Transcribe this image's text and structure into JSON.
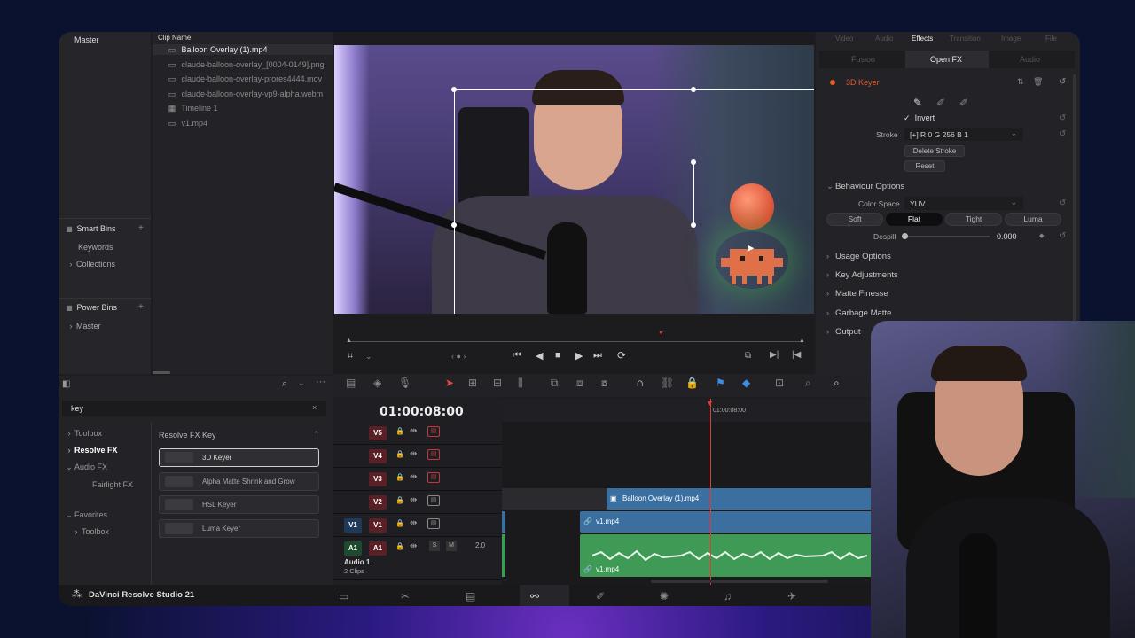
{
  "media_pool": {
    "master_label": "Master",
    "column_header": "Clip Name",
    "clips": [
      {
        "name": "Balloon Overlay (1).mp4",
        "icon": "video-clip-icon"
      },
      {
        "name": "claude-balloon-overlay_[0004-0149].png",
        "icon": "image-sequence-icon"
      },
      {
        "name": "claude-balloon-overlay-prores4444.mov",
        "icon": "video-clip-icon"
      },
      {
        "name": "claude-balloon-overlay-vp9-alpha.webm",
        "icon": "video-clip-icon"
      },
      {
        "name": "Timeline 1",
        "icon": "timeline-icon"
      },
      {
        "name": "v1.mp4",
        "icon": "video-clip-icon"
      }
    ],
    "smart_bins": {
      "title": "Smart Bins",
      "items": [
        "Keywords",
        "Collections"
      ]
    },
    "power_bins": {
      "title": "Power Bins",
      "items": [
        "Master"
      ]
    }
  },
  "effects_library": {
    "search_value": "key",
    "categories": [
      {
        "label": "Toolbox",
        "expanded": false
      },
      {
        "label": "Resolve FX",
        "expanded": true,
        "selected": true
      },
      {
        "label": "Audio FX",
        "expanded": true
      },
      {
        "label": "Fairlight FX",
        "expanded": false
      }
    ],
    "favorites": {
      "label": "Favorites",
      "items": [
        "Toolbox"
      ]
    },
    "group_title": "Resolve FX Key",
    "results": [
      "3D Keyer",
      "Alpha Matte Shrink and Grow",
      "HSL Keyer",
      "Luma Keyer"
    ]
  },
  "viewer": {
    "timecode": "01:00:08:00"
  },
  "inspector": {
    "tabs": [
      "Video",
      "Audio",
      "Effects",
      "Transition",
      "Image",
      "File"
    ],
    "active_tab": "Effects",
    "subtabs": [
      "Fusion",
      "Open FX",
      "Audio"
    ],
    "active_subtab": "Open FX",
    "effect_name": "3D Keyer",
    "invert_label": "Invert",
    "stroke_label": "Stroke",
    "stroke_value": "[+]   R 0   G 256   B 1",
    "delete_stroke": "Delete Stroke",
    "reset": "Reset",
    "behaviour_title": "Behaviour Options",
    "color_space_label": "Color Space",
    "color_space_value": "YUV",
    "modes": [
      "Soft",
      "Flat",
      "Tight",
      "Luma"
    ],
    "active_mode": "Flat",
    "despill_label": "Despill",
    "despill_value": "0.000",
    "sections": [
      "Usage Options",
      "Key Adjustments",
      "Matte Finesse",
      "Garbage Matte",
      "Output"
    ]
  },
  "timeline": {
    "ruler_time": "01:00:08:00",
    "tracks": [
      {
        "label": "V5"
      },
      {
        "label": "V4"
      },
      {
        "label": "V3"
      },
      {
        "label": "V2"
      },
      {
        "label": "V1",
        "side": "V1"
      },
      {
        "label": "A1",
        "side": "A1",
        "volume": "2.0"
      }
    ],
    "audio_track_name": "Audio 1",
    "audio_track_clips": "2 Clips",
    "solo_label": "S",
    "mute_label": "M",
    "clips": {
      "v2": "Balloon Overlay (1).mp4",
      "v1": "v1.mp4",
      "a1": "v1.mp4"
    }
  },
  "footer": {
    "app_name": "DaVinci Resolve Studio 21"
  },
  "colors": {
    "accent_orange": "#e05a2a",
    "active_tab": "#e8e8e8",
    "playhead": "#e03a3a",
    "video_clip": "#3a6fa0",
    "audio_clip": "#3f9a55",
    "track_label_red": "#5a2026"
  }
}
